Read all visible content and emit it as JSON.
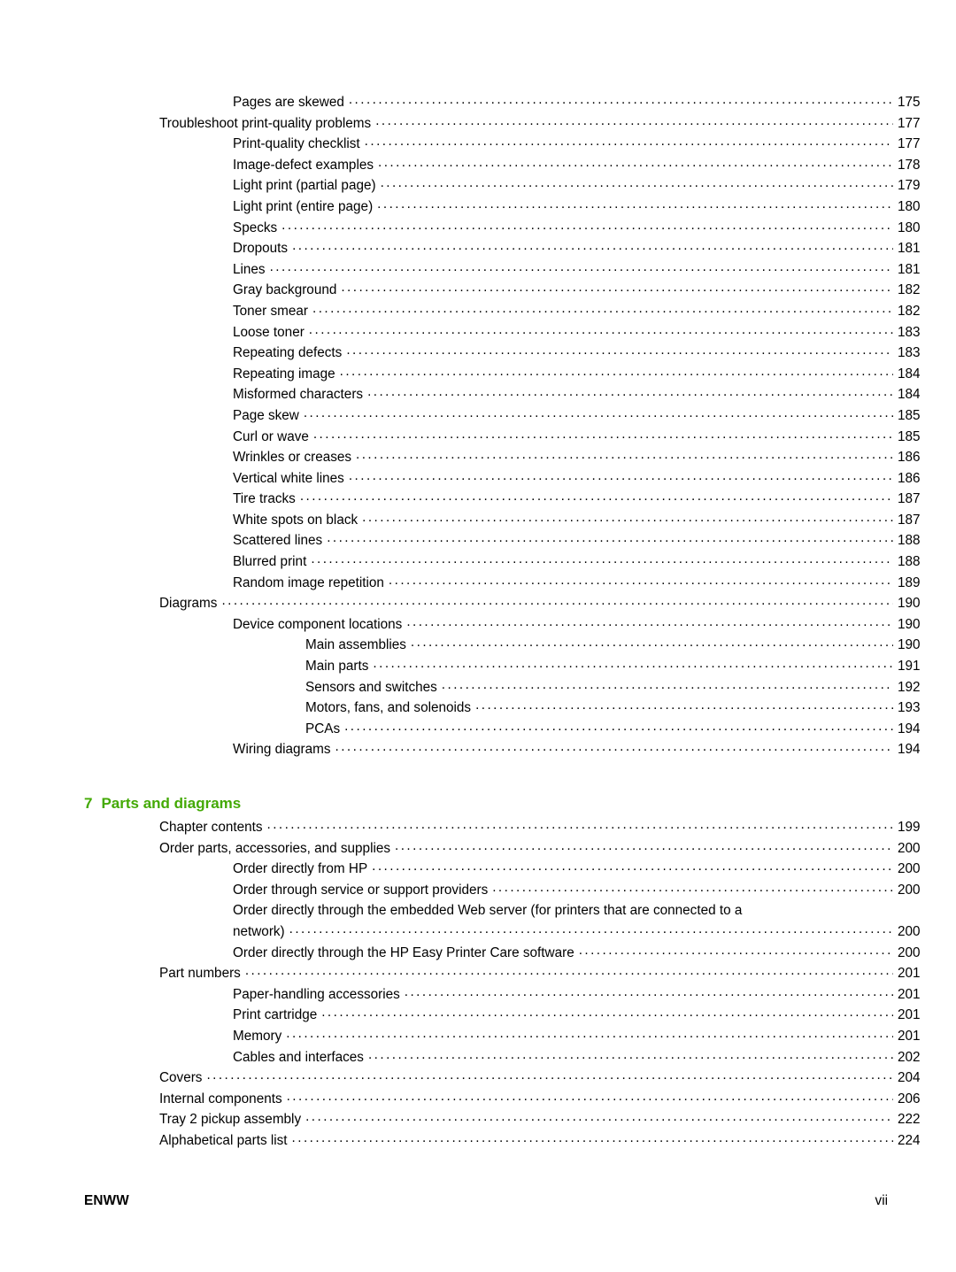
{
  "document": {
    "type": "table-of-contents",
    "footer": {
      "left_label": "ENWW",
      "page_number": "vii"
    }
  },
  "chapter_heading": {
    "number": "7",
    "title": "Parts and diagrams",
    "color": "#43a904"
  },
  "toc_entries": [
    {
      "level": 2,
      "title": "Pages are skewed",
      "page": "175"
    },
    {
      "level": 1,
      "title": "Troubleshoot print-quality problems",
      "page": "177"
    },
    {
      "level": 2,
      "title": "Print-quality checklist",
      "page": "177"
    },
    {
      "level": 2,
      "title": "Image-defect examples",
      "page": "178"
    },
    {
      "level": 2,
      "title": "Light print (partial page)",
      "page": "179"
    },
    {
      "level": 2,
      "title": "Light print (entire page)",
      "page": "180"
    },
    {
      "level": 2,
      "title": "Specks",
      "page": "180"
    },
    {
      "level": 2,
      "title": "Dropouts",
      "page": "181"
    },
    {
      "level": 2,
      "title": "Lines",
      "page": "181"
    },
    {
      "level": 2,
      "title": "Gray background",
      "page": "182"
    },
    {
      "level": 2,
      "title": "Toner smear",
      "page": "182"
    },
    {
      "level": 2,
      "title": "Loose toner",
      "page": "183"
    },
    {
      "level": 2,
      "title": "Repeating defects",
      "page": "183"
    },
    {
      "level": 2,
      "title": "Repeating image",
      "page": "184"
    },
    {
      "level": 2,
      "title": "Misformed characters",
      "page": "184"
    },
    {
      "level": 2,
      "title": "Page skew",
      "page": "185"
    },
    {
      "level": 2,
      "title": "Curl or wave",
      "page": "185"
    },
    {
      "level": 2,
      "title": "Wrinkles or creases",
      "page": "186"
    },
    {
      "level": 2,
      "title": "Vertical white lines",
      "page": "186"
    },
    {
      "level": 2,
      "title": "Tire tracks",
      "page": "187"
    },
    {
      "level": 2,
      "title": "White spots on black",
      "page": "187"
    },
    {
      "level": 2,
      "title": "Scattered lines",
      "page": "188"
    },
    {
      "level": 2,
      "title": "Blurred print",
      "page": "188"
    },
    {
      "level": 2,
      "title": "Random image repetition",
      "page": "189"
    },
    {
      "level": 1,
      "title": "Diagrams",
      "page": "190"
    },
    {
      "level": 2,
      "title": "Device component locations",
      "page": "190"
    },
    {
      "level": 3,
      "title": "Main assemblies",
      "page": "190"
    },
    {
      "level": 3,
      "title": "Main parts",
      "page": "191"
    },
    {
      "level": 3,
      "title": "Sensors and switches",
      "page": "192"
    },
    {
      "level": 3,
      "title": "Motors, fans, and solenoids",
      "page": "193"
    },
    {
      "level": 3,
      "title": "PCAs",
      "page": "194"
    },
    {
      "level": 2,
      "title": "Wiring diagrams",
      "page": "194"
    }
  ],
  "toc_entries_chapter7": [
    {
      "level": 1,
      "title": "Chapter contents",
      "page": "199"
    },
    {
      "level": 1,
      "title": "Order parts, accessories, and supplies",
      "page": "200"
    },
    {
      "level": 2,
      "title": "Order directly from HP",
      "page": "200"
    },
    {
      "level": 2,
      "title": "Order through service or support providers",
      "page": "200"
    },
    {
      "level": 2,
      "wrapped": true,
      "title": "Order directly through the embedded Web server (for printers that are connected to a",
      "title_cont": "network)",
      "page": "200"
    },
    {
      "level": 2,
      "title": "Order directly through the HP Easy Printer Care software",
      "page": "200"
    },
    {
      "level": 1,
      "title": "Part numbers",
      "page": "201"
    },
    {
      "level": 2,
      "title": "Paper-handling accessories",
      "page": "201"
    },
    {
      "level": 2,
      "title": "Print cartridge",
      "page": "201"
    },
    {
      "level": 2,
      "title": "Memory",
      "page": "201"
    },
    {
      "level": 2,
      "title": "Cables and interfaces",
      "page": "202"
    },
    {
      "level": 1,
      "title": "Covers",
      "page": "204"
    },
    {
      "level": 1,
      "title": "Internal components",
      "page": "206"
    },
    {
      "level": 1,
      "title": "Tray 2 pickup assembly",
      "page": "222"
    },
    {
      "level": 1,
      "title": "Alphabetical parts list",
      "page": "224"
    }
  ]
}
